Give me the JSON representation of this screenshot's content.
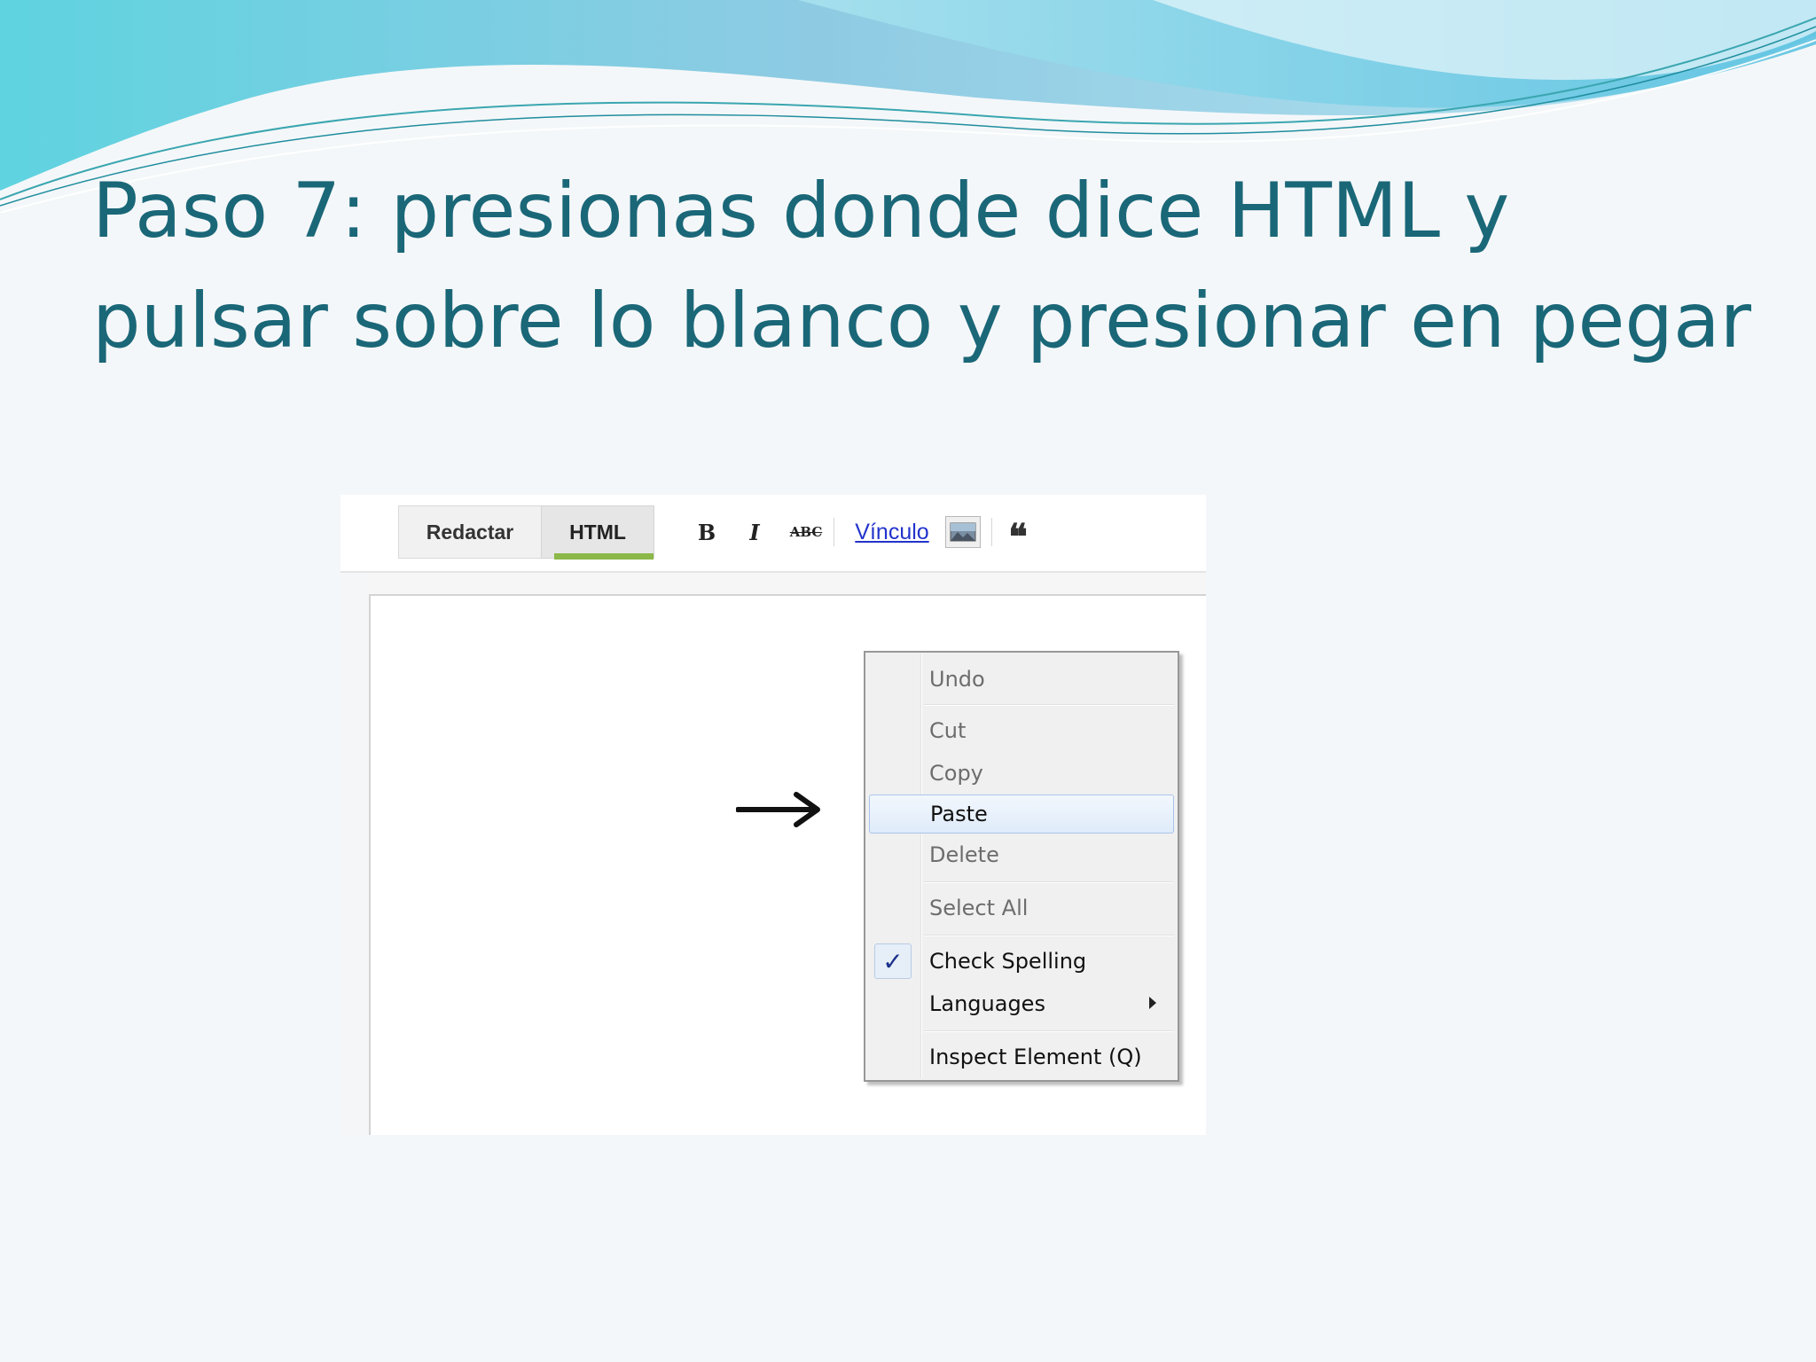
{
  "slide": {
    "title": "Paso 7: presionas donde dice HTML y pulsar sobre lo blanco y presionar en pegar"
  },
  "editor": {
    "tabs": [
      "Redactar",
      "HTML"
    ],
    "active_tab": "HTML",
    "toolbar": {
      "bold": "B",
      "italic": "I",
      "strike": "ABC",
      "link": "Vínculo",
      "quote": "❝"
    }
  },
  "context_menu": {
    "items": [
      {
        "label": "Undo",
        "enabled": false
      },
      {
        "label": "Cut",
        "enabled": false
      },
      {
        "label": "Copy",
        "enabled": false
      },
      {
        "label": "Paste",
        "enabled": true,
        "highlighted": true
      },
      {
        "label": "Delete",
        "enabled": false
      },
      {
        "label": "Select All",
        "enabled": false
      },
      {
        "label": "Check Spelling",
        "enabled": true,
        "checked": true
      },
      {
        "label": "Languages",
        "enabled": true,
        "submenu": true
      },
      {
        "label": "Inspect Element (Q)",
        "enabled": true
      }
    ],
    "check_mark": "✓"
  },
  "colors": {
    "title": "#1a6778",
    "tab_underline": "#8bb849",
    "link": "#2233cc",
    "menu_highlight": "#dfebfa"
  },
  "icons": [
    "image-icon",
    "quote-icon",
    "submenu-arrow-icon",
    "right-arrow-icon",
    "check-icon"
  ]
}
